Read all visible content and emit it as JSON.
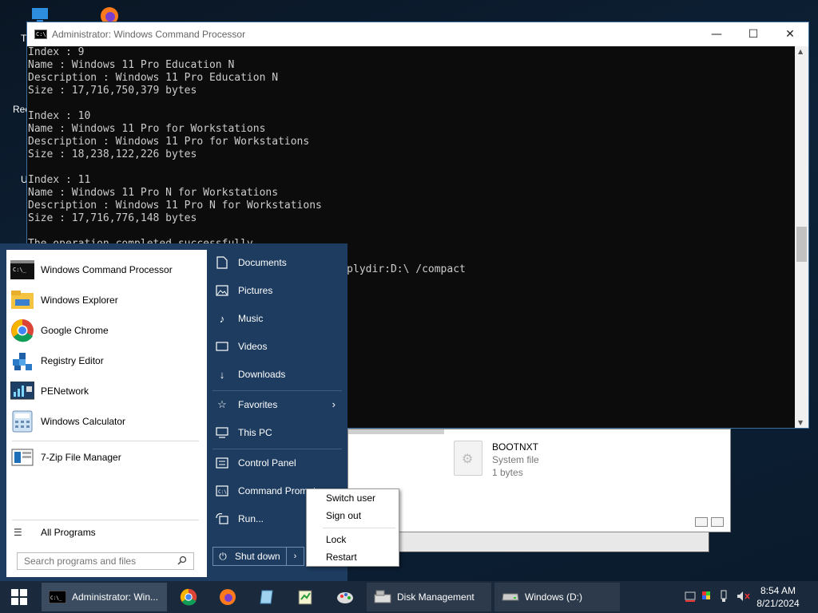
{
  "desktop": {
    "partial_labels": [
      "T",
      "Rec",
      "U"
    ]
  },
  "explorer_bg": {
    "file_name": "BOOTNXT",
    "file_type": "System file",
    "file_size": "1 bytes"
  },
  "cmd": {
    "title": "Administrator: Windows Command Processor",
    "lines": [
      "Index : 9",
      "Name : Windows 11 Pro Education N",
      "Description : Windows 11 Pro Education N",
      "Size : 17,716,750,379 bytes",
      "",
      "Index : 10",
      "Name : Windows 11 Pro for Workstations",
      "Description : Windows 11 Pro for Workstations",
      "Size : 18,238,122,226 bytes",
      "",
      "Index : 11",
      "Name : Windows 11 Pro N for Workstations",
      "Description : Windows 11 Pro N for Workstations",
      "Size : 17,716,776,148 bytes",
      "",
      "The operation completed successfully.",
      "",
      "                                     m /index:6 /applydir:D:\\ /compact",
      "",
      "",
      "",
      "",
      "                                     ==========]"
    ],
    "controls": {
      "minimize": "—",
      "maximize": "☐",
      "close": "✕"
    }
  },
  "start_menu": {
    "programs": [
      {
        "label": "Windows Command Processor",
        "icon": "cmd-icon"
      },
      {
        "label": "Windows Explorer",
        "icon": "explorer-icon"
      },
      {
        "label": "Google Chrome",
        "icon": "chrome-icon"
      },
      {
        "label": "Registry Editor",
        "icon": "regedit-icon"
      },
      {
        "label": "PENetwork",
        "icon": "penetwork-icon"
      },
      {
        "label": "Windows Calculator",
        "icon": "calculator-icon"
      },
      {
        "label": "7-Zip File Manager",
        "icon": "7zip-icon"
      }
    ],
    "all_programs": "All Programs",
    "search_placeholder": "Search programs and files",
    "places": [
      {
        "label": "Documents",
        "icon": "documents-icon"
      },
      {
        "label": "Pictures",
        "icon": "pictures-icon"
      },
      {
        "label": "Music",
        "icon": "music-icon"
      },
      {
        "label": "Videos",
        "icon": "videos-icon"
      },
      {
        "label": "Downloads",
        "icon": "downloads-icon"
      },
      {
        "label": "Favorites",
        "icon": "star-icon"
      },
      {
        "label": "This PC",
        "icon": "computer-icon"
      },
      {
        "label": "Control Panel",
        "icon": "control-panel-icon"
      },
      {
        "label": "Command Prompt",
        "icon": "cmd-icon"
      },
      {
        "label": "Run...",
        "icon": "run-icon"
      }
    ],
    "shutdown_label": "Shut down",
    "power_menu": [
      "Switch user",
      "Sign out",
      "Lock",
      "Restart"
    ]
  },
  "taskbar": {
    "items": [
      {
        "label": "Administrator: Win...",
        "icon": "cmd-icon",
        "state": "active"
      },
      {
        "label": "Disk Management",
        "icon": "disk-management-icon",
        "state": "normal"
      },
      {
        "label": "Windows (D:)",
        "icon": "drive-icon",
        "state": "normal"
      }
    ],
    "pinned": [
      "chrome-icon",
      "firefox-icon",
      "app-icon",
      "notepad-icon",
      "paint-icon"
    ],
    "time": "8:54 AM",
    "date": "8/21/2024"
  },
  "colors": {
    "start_menu_bg": "#1d3c5f",
    "taskbar_bg": "#1a2a3c",
    "cmd_bg": "#0c0c0c",
    "cmd_text": "#cccccc"
  }
}
